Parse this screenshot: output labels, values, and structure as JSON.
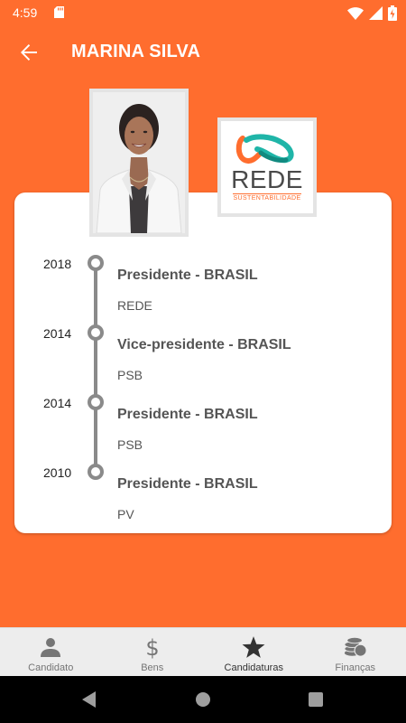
{
  "status_bar": {
    "time": "4:59"
  },
  "header": {
    "title": "MARINA SILVA",
    "back_icon": "arrow-back-icon"
  },
  "party_logo": {
    "name": "REDE",
    "subtitle": "SUSTENTABILIDADE"
  },
  "colors": {
    "accent": "#FF6D2E",
    "card": "#FFFFFF",
    "timeline": "#8A8A8A",
    "nav_background": "#EDEDED"
  },
  "candidacies": [
    {
      "year": "2018",
      "office": "Presidente - BRASIL",
      "party": "REDE"
    },
    {
      "year": "2014",
      "office": "Vice-presidente - BRASIL",
      "party": "PSB"
    },
    {
      "year": "2014",
      "office": "Presidente - BRASIL",
      "party": "PSB"
    },
    {
      "year": "2010",
      "office": "Presidente - BRASIL",
      "party": "PV"
    }
  ],
  "bottom_nav": {
    "tabs": [
      {
        "label": "Candidato",
        "icon": "person-icon",
        "active": false
      },
      {
        "label": "Bens",
        "icon": "dollar-icon",
        "active": false
      },
      {
        "label": "Candidaturas",
        "icon": "star-icon",
        "active": true
      },
      {
        "label": "Finanças",
        "icon": "coins-icon",
        "active": false
      }
    ]
  }
}
